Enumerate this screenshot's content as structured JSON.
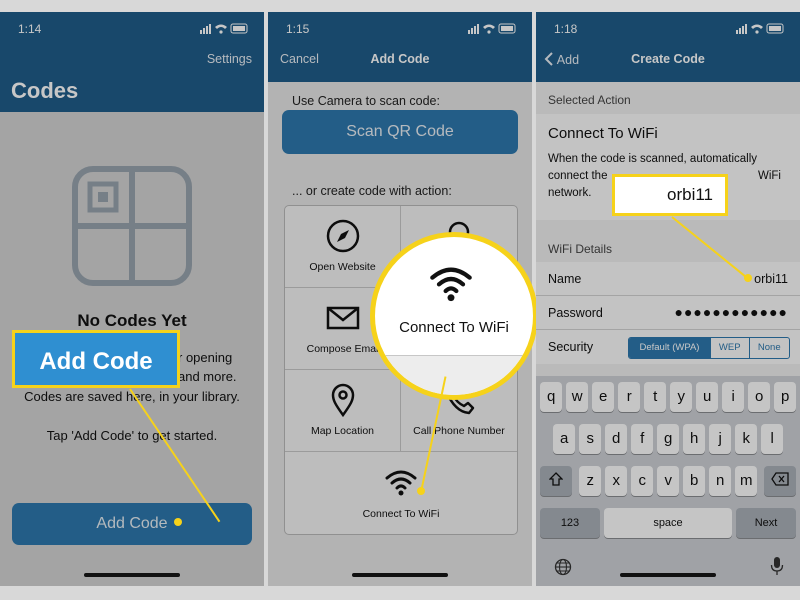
{
  "colors": {
    "brand": "#1f5d89",
    "button": "#2d78ad",
    "highlight": "#f6d21a"
  },
  "phone1": {
    "time": "1:14",
    "title": "Codes",
    "settings": "Settings",
    "empty_title": "No Codes Yet",
    "desc_line1": "r opening",
    "desc_line2": "and more.",
    "desc_line3": "Codes are saved here, in your library.",
    "tap_hint": "Tap 'Add Code' to get started.",
    "add_button": "Add Code",
    "callout": "Add Code",
    "placeholder_icon": "qr-placeholder-icon"
  },
  "phone2": {
    "time": "1:15",
    "cancel": "Cancel",
    "title": "Add Code",
    "camera_label": "Use Camera to scan code:",
    "scan_button": "Scan QR Code",
    "create_label": "... or create code with action:",
    "actions": {
      "open_website": "Open Website",
      "compose_email": "Compose Emai",
      "map_location": "Map Location",
      "call_phone": "Call Phone Number",
      "connect_wifi": "Connect To WiFi"
    },
    "magnifier_label": "Connect To WiFi"
  },
  "phone3": {
    "time": "1:18",
    "back": "Add",
    "title": "Create Code",
    "selected_action_header": "Selected Action",
    "action_title": "Connect To WiFi",
    "desc_line1": "When the code is scanned, automatically",
    "desc_line2a": "connect the",
    "desc_line2b": "WiFi",
    "desc_line3": "network.",
    "wifi_details_header": "WiFi Details",
    "name_label": "Name",
    "name_value": "orbi11",
    "password_label": "Password",
    "password_value": "●●●●●●●●●●●●",
    "security_label": "Security",
    "security_options": [
      "Default (WPA)",
      "WEP",
      "None"
    ],
    "security_selected": "Default (WPA)",
    "callout": "orbi11",
    "keyboard": {
      "row1": [
        "q",
        "w",
        "e",
        "r",
        "t",
        "y",
        "u",
        "i",
        "o",
        "p"
      ],
      "row2": [
        "a",
        "s",
        "d",
        "f",
        "g",
        "h",
        "j",
        "k",
        "l"
      ],
      "row3": [
        "z",
        "x",
        "c",
        "v",
        "b",
        "n",
        "m"
      ],
      "numbers": "123",
      "space": "space",
      "next": "Next"
    }
  }
}
